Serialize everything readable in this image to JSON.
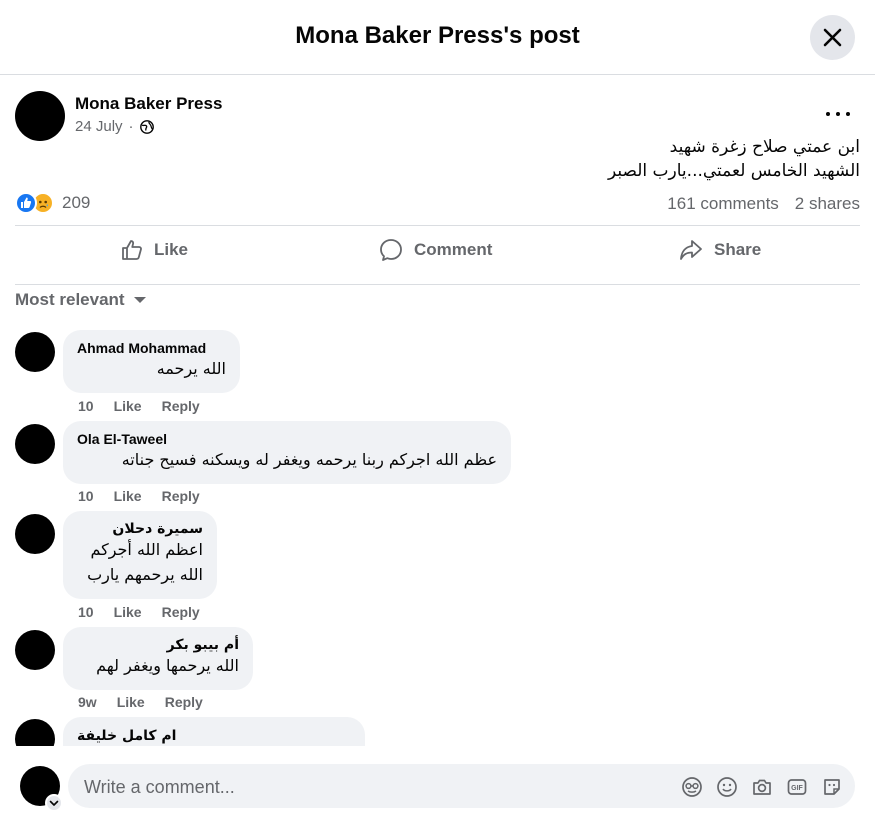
{
  "header": {
    "title": "Mona Baker Press's post"
  },
  "post": {
    "author": "Mona Baker Press",
    "date": "24 July",
    "separator": "·",
    "text_lines": [
      "ابن عمتي صلاح زغرة شهيد",
      "الشهيد الخامس لعمتي...يارب الصبر"
    ],
    "reaction_count": "209",
    "comments_count": "161 comments",
    "shares_count": "2 shares"
  },
  "actions": {
    "like": "Like",
    "comment": "Comment",
    "share": "Share"
  },
  "sort_label": "Most relevant",
  "comments": [
    {
      "name": "Ahmad Mohammad",
      "lines": [
        "الله يرحمه"
      ],
      "time": "10",
      "like": "Like",
      "reply": "Reply"
    },
    {
      "name": "Ola El-Taweel",
      "lines": [
        "عظم الله اجركم ربنا يرحمه ويغفر له ويسكنه فسيح جناته"
      ],
      "time": "10",
      "like": "Like",
      "reply": "Reply"
    },
    {
      "name": "سميرة دحلان",
      "lines": [
        "اعظم الله أجركم",
        "الله يرحمهم يارب"
      ],
      "time": "10",
      "like": "Like",
      "reply": "Reply"
    },
    {
      "name": "أم بيبو بكر",
      "lines": [
        "الله يرحمها ويغفر لهم"
      ],
      "time": "9w",
      "like": "Like",
      "reply": "Reply"
    },
    {
      "name": "ام كامل خليفة",
      "lines": [],
      "time": "",
      "like": "",
      "reply": ""
    }
  ],
  "composer": {
    "placeholder": "Write a comment..."
  },
  "icons": [
    "close-icon",
    "globe-icon",
    "more-icon",
    "like-reaction-icon",
    "sad-reaction-icon",
    "like-icon",
    "comment-icon",
    "share-icon",
    "caret-down-icon",
    "avatar-icon",
    "sticker-icon",
    "emoji-icon",
    "camera-icon",
    "gif-icon",
    "sticker-face-icon"
  ],
  "colors": {
    "accent": "#1877f2",
    "muted": "#65676b",
    "bubble": "#f0f2f5"
  }
}
